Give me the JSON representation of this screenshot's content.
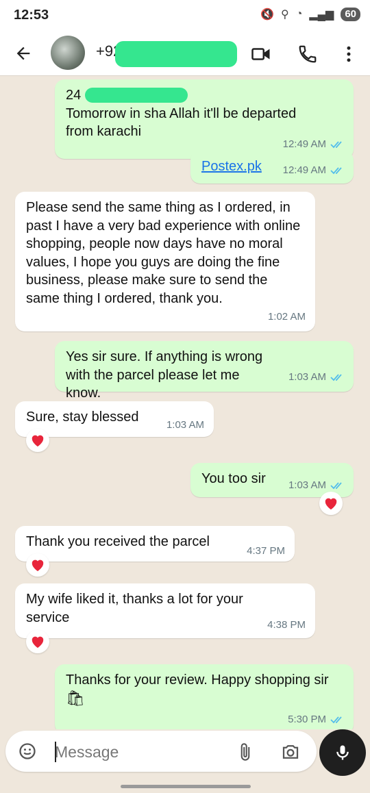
{
  "status": {
    "time": "12:53",
    "battery": "60"
  },
  "header": {
    "contact": "+92"
  },
  "messages": [
    {
      "dir": "out",
      "lines": [
        "24",
        "Tomorrow in sha Allah it'll be departed",
        "from karachi"
      ],
      "time": "12:49 AM"
    },
    {
      "dir": "out",
      "link": "Postex.pk",
      "time": "12:49 AM"
    },
    {
      "dir": "in",
      "text": "Please send the same thing as I ordered, in past I have a very bad experience with online shopping, people now days have no moral values, I hope you guys are doing the fine business, please make sure to send the same thing I ordered, thank you.",
      "time": "1:02 AM"
    },
    {
      "dir": "out",
      "text": "Yes sir sure. If anything is wrong with the parcel please let me know.",
      "time": "1:03 AM"
    },
    {
      "dir": "in",
      "text": "Sure, stay blessed",
      "time": "1:03 AM",
      "reaction": "heart"
    },
    {
      "dir": "out",
      "text": "You too sir",
      "time": "1:03 AM",
      "reaction": "heart"
    },
    {
      "dir": "in",
      "text": "Thank you received the parcel",
      "time": "4:37 PM",
      "reaction": "heart"
    },
    {
      "dir": "in",
      "text": "My wife liked it, thanks a lot for your service",
      "time": "4:38 PM",
      "reaction": "heart"
    },
    {
      "dir": "out",
      "text": "Thanks for your review. Happy shopping sir",
      "time": "5:30 PM"
    }
  ],
  "composer": {
    "placeholder": "Message"
  },
  "colors": {
    "outgoing": "#d8fdd2",
    "incoming": "#ffffff",
    "tick": "#53bdeb",
    "reaction": "#e8253b"
  }
}
